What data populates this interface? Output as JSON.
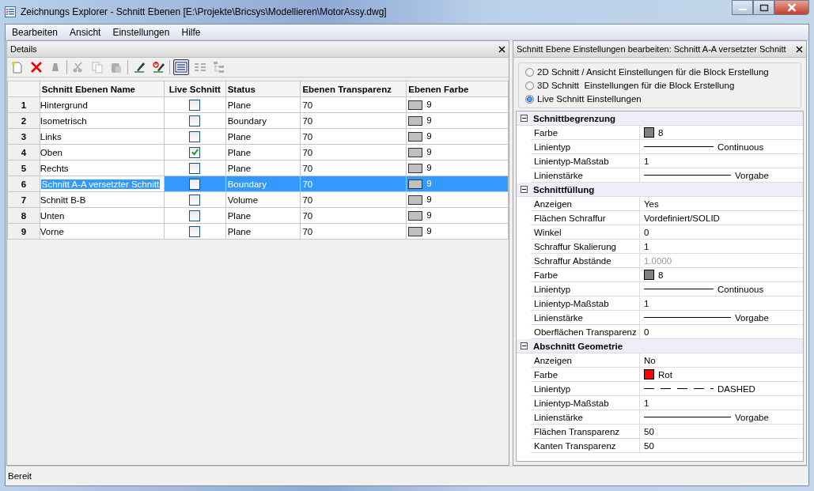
{
  "window": {
    "title": "Zeichnungs Explorer - Schnitt Ebenen [E:\\Projekte\\Bricsys\\Modellieren\\MotorAssy.dwg]"
  },
  "menu": [
    "Bearbeiten",
    "Ansicht",
    "Einstellungen",
    "Hilfe"
  ],
  "details": {
    "title": "Details",
    "toolbar": [
      {
        "kind": "new",
        "disabled": false,
        "selected": false
      },
      {
        "kind": "delete",
        "disabled": false,
        "selected": false
      },
      {
        "kind": "purge",
        "disabled": true,
        "selected": false
      },
      {
        "kind": "sep"
      },
      {
        "kind": "cut",
        "disabled": true,
        "selected": false
      },
      {
        "kind": "copy",
        "disabled": true,
        "selected": false
      },
      {
        "kind": "paste",
        "disabled": true,
        "selected": false
      },
      {
        "kind": "sep"
      },
      {
        "kind": "pen",
        "disabled": false,
        "selected": false
      },
      {
        "kind": "pen-power",
        "disabled": false,
        "selected": false
      },
      {
        "kind": "sep"
      },
      {
        "kind": "list",
        "disabled": false,
        "selected": true
      },
      {
        "kind": "grid",
        "disabled": true,
        "selected": false
      },
      {
        "kind": "tree",
        "disabled": true,
        "selected": false
      }
    ],
    "table": {
      "columns": [
        "Schnitt Ebenen Name",
        "Live Schnitt",
        "Status",
        "Ebenen Transparenz",
        "Ebenen Farbe"
      ],
      "rows": [
        {
          "index": "1",
          "name": "Hintergrund",
          "live": false,
          "status": "Plane",
          "transparency": "70",
          "color": "#c0c0c0",
          "color_label": "9",
          "selected": false
        },
        {
          "index": "2",
          "name": "Isometrisch",
          "live": false,
          "status": "Boundary",
          "transparency": "70",
          "color": "#c0c0c0",
          "color_label": "9",
          "selected": false
        },
        {
          "index": "3",
          "name": "Links",
          "live": false,
          "status": "Plane",
          "transparency": "70",
          "color": "#c0c0c0",
          "color_label": "9",
          "selected": false
        },
        {
          "index": "4",
          "name": "Oben",
          "live": true,
          "status": "Plane",
          "transparency": "70",
          "color": "#c0c0c0",
          "color_label": "9",
          "selected": false
        },
        {
          "index": "5",
          "name": "Rechts",
          "live": false,
          "status": "Plane",
          "transparency": "70",
          "color": "#c0c0c0",
          "color_label": "9",
          "selected": false
        },
        {
          "index": "6",
          "name": "Schnitt A-A versetzter Schnitt",
          "live": false,
          "status": "Boundary",
          "transparency": "70",
          "color": "#c0c0c0",
          "color_label": "9",
          "selected": true
        },
        {
          "index": "7",
          "name": "Schnitt B-B",
          "live": false,
          "status": "Volume",
          "transparency": "70",
          "color": "#c0c0c0",
          "color_label": "9",
          "selected": false
        },
        {
          "index": "8",
          "name": "Unten",
          "live": false,
          "status": "Plane",
          "transparency": "70",
          "color": "#c0c0c0",
          "color_label": "9",
          "selected": false
        },
        {
          "index": "9",
          "name": "Vorne",
          "live": false,
          "status": "Plane",
          "transparency": "70",
          "color": "#c0c0c0",
          "color_label": "9",
          "selected": false
        }
      ]
    }
  },
  "settings": {
    "title": "Schnitt Ebene Einstellungen bearbeiten: Schnitt A-A versetzter Schnitt",
    "modes": [
      {
        "label": "2D Schnitt / Ansicht Einstellungen für die Block Erstellung",
        "selected": false
      },
      {
        "label": "3D Schnitt  Einstellungen für die Block Erstellung",
        "selected": false
      },
      {
        "label": "Live Schnitt Einstellungen",
        "selected": true
      }
    ],
    "groups": [
      {
        "title": "Schnittbegrenzung",
        "expanded": true,
        "properties": [
          {
            "name": "Farbe",
            "kind": "swatch",
            "color": "#808080",
            "value": "8"
          },
          {
            "name": "Linientyp",
            "kind": "line",
            "value": "Continuous"
          },
          {
            "name": "Linientyp-Maßstab",
            "kind": "text",
            "value": "1"
          },
          {
            "name": "Linienstärke",
            "kind": "weight",
            "value": "Vorgabe"
          }
        ]
      },
      {
        "title": "Schnittfüllung",
        "expanded": true,
        "properties": [
          {
            "name": "Anzeigen",
            "kind": "text",
            "value": "Yes"
          },
          {
            "name": "Flächen Schraffur",
            "kind": "text",
            "value": "Vordefiniert/SOLID"
          },
          {
            "name": "Winkel",
            "kind": "text",
            "value": "0"
          },
          {
            "name": "Schraffur Skalierung",
            "kind": "text",
            "value": "1"
          },
          {
            "name": "Schraffur Abstände",
            "kind": "text",
            "value": "1.0000",
            "disabled": true
          },
          {
            "name": "Farbe",
            "kind": "swatch",
            "color": "#808080",
            "value": "8"
          },
          {
            "name": "Linientyp",
            "kind": "line",
            "value": "Continuous"
          },
          {
            "name": "Linientyp-Maßstab",
            "kind": "text",
            "value": "1"
          },
          {
            "name": "Linienstärke",
            "kind": "weight",
            "value": "Vorgabe"
          },
          {
            "name": "Oberflächen Transparenz",
            "kind": "text",
            "value": "0"
          }
        ]
      },
      {
        "title": "Abschnitt Geometrie",
        "expanded": true,
        "properties": [
          {
            "name": "Anzeigen",
            "kind": "text",
            "value": "No"
          },
          {
            "name": "Farbe",
            "kind": "swatch",
            "color": "#ff0000",
            "value": "Rot"
          },
          {
            "name": "Linientyp",
            "kind": "dashed",
            "value": "DASHED"
          },
          {
            "name": "Linientyp-Maßstab",
            "kind": "text",
            "value": "1"
          },
          {
            "name": "Linienstärke",
            "kind": "weight",
            "value": "Vorgabe"
          },
          {
            "name": "Flächen Transparenz",
            "kind": "text",
            "value": "50"
          },
          {
            "name": "Kanten Transparenz",
            "kind": "text",
            "value": "50"
          }
        ]
      }
    ]
  },
  "status_bar": "Bereit"
}
